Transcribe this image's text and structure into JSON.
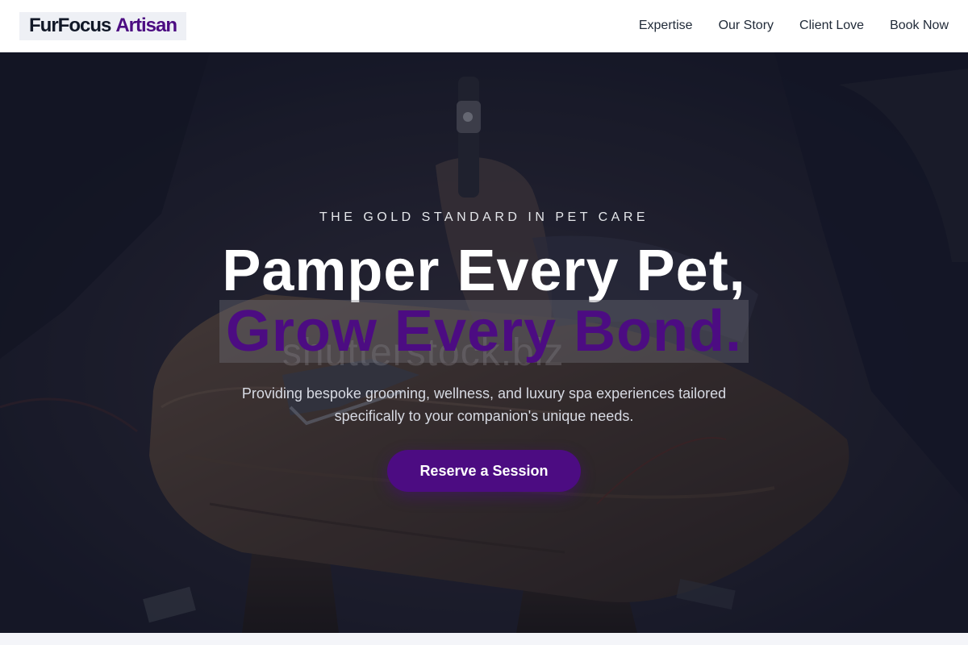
{
  "header": {
    "logo": {
      "primary": "FurFocus",
      "accent": "Artisan"
    },
    "nav": [
      {
        "label": "Expertise"
      },
      {
        "label": "Our Story"
      },
      {
        "label": "Client Love"
      },
      {
        "label": "Book Now"
      }
    ]
  },
  "hero": {
    "eyebrow": "THE GOLD STANDARD IN PET CARE",
    "title_line1": "Pamper Every Pet,",
    "title_line2": "Grow Every Bond.",
    "watermark": "shutterstock.biz",
    "subtitle": "Providing bespoke grooming, wellness, and luxury spa experiences tailored specifically to your companion's unique needs.",
    "cta_label": "Reserve a Session"
  },
  "colors": {
    "accent": "#4c0c82",
    "hero_overlay": "#121426"
  }
}
